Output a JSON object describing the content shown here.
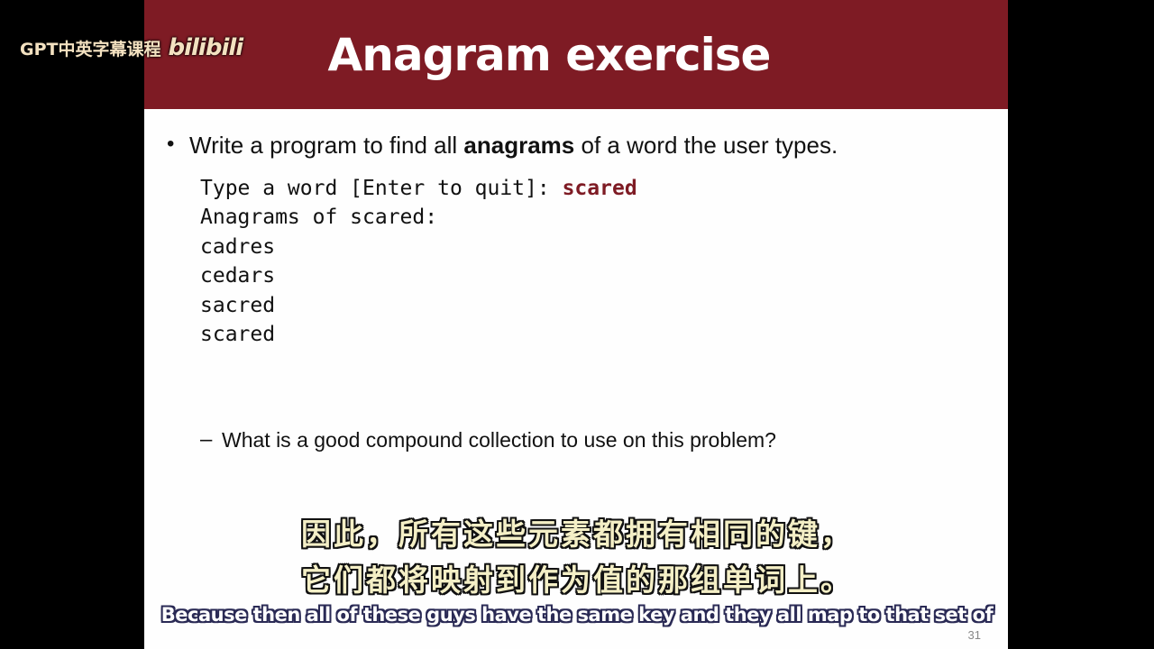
{
  "watermark": {
    "text": "GPT中英字幕课程",
    "logo": "bilibili"
  },
  "slide": {
    "title": "Anagram exercise",
    "bullet": {
      "pre": "Write a program to find all ",
      "bold": "anagrams",
      "post": " of a word the user types."
    },
    "code": {
      "prompt": "Type a word [Enter to quit]: ",
      "input": "scared",
      "lines": [
        "Anagrams of scared:",
        "cadres",
        "cedars",
        "sacred",
        "scared"
      ]
    },
    "sub_bullet": "What is a good compound collection to use on this problem?",
    "slide_number": "31"
  },
  "subtitles": {
    "cn_line1": "因此，所有这些元素都拥有相同的键，",
    "cn_line2": "它们都将映射到作为值的那组单词上。",
    "en_line": "Because then all of these guys have the same key and they all map to that set of"
  },
  "colors": {
    "title_bar": "#7e1b24",
    "code_accent": "#7e1b24"
  }
}
